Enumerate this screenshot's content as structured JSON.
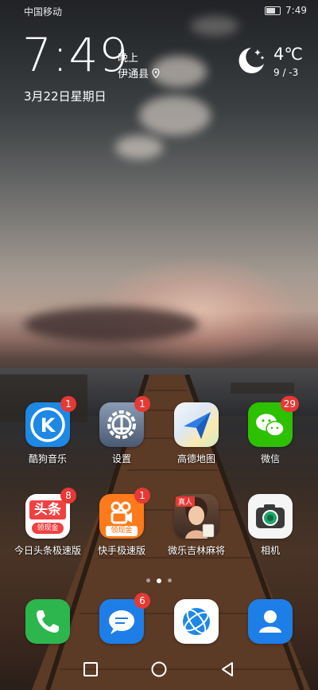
{
  "status_bar": {
    "carrier": "中国移动",
    "time": "7:49"
  },
  "clock_widget": {
    "time": "7:49",
    "ampm": "晚上",
    "location": "伊通县",
    "date": "3月22日星期日"
  },
  "weather": {
    "temperature": "4℃",
    "range": "9 / -3"
  },
  "apps_row1": [
    {
      "label": "酷狗音乐",
      "badge": "1",
      "icon": "kugou-music-icon",
      "color": "#1e88e5"
    },
    {
      "label": "设置",
      "badge": "1",
      "icon": "settings-gear-icon",
      "color": "#4a5a72"
    },
    {
      "label": "高德地图",
      "badge": "",
      "icon": "amap-icon",
      "color": "#2f7de1"
    },
    {
      "label": "微信",
      "badge": "29",
      "icon": "wechat-icon",
      "color": "#2dc100"
    }
  ],
  "apps_row2": [
    {
      "label": "今日头条极速版",
      "badge": "8",
      "icon": "toutiao-lite-icon",
      "text": "头条",
      "subtext": "领现金"
    },
    {
      "label": "快手极速版",
      "badge": "1",
      "icon": "kuaishou-lite-icon",
      "subtext": "领现金"
    },
    {
      "label": "微乐吉林麻将",
      "badge": "",
      "icon": "mahjong-game-icon",
      "text": "真人"
    },
    {
      "label": "相机",
      "badge": "",
      "icon": "camera-icon"
    }
  ],
  "dock": [
    {
      "icon": "phone-icon",
      "badge": ""
    },
    {
      "icon": "messages-icon",
      "badge": "6"
    },
    {
      "icon": "browser-icon",
      "badge": ""
    },
    {
      "icon": "contacts-icon",
      "badge": ""
    }
  ],
  "page_indicator": {
    "pages": 3,
    "active": 2
  }
}
